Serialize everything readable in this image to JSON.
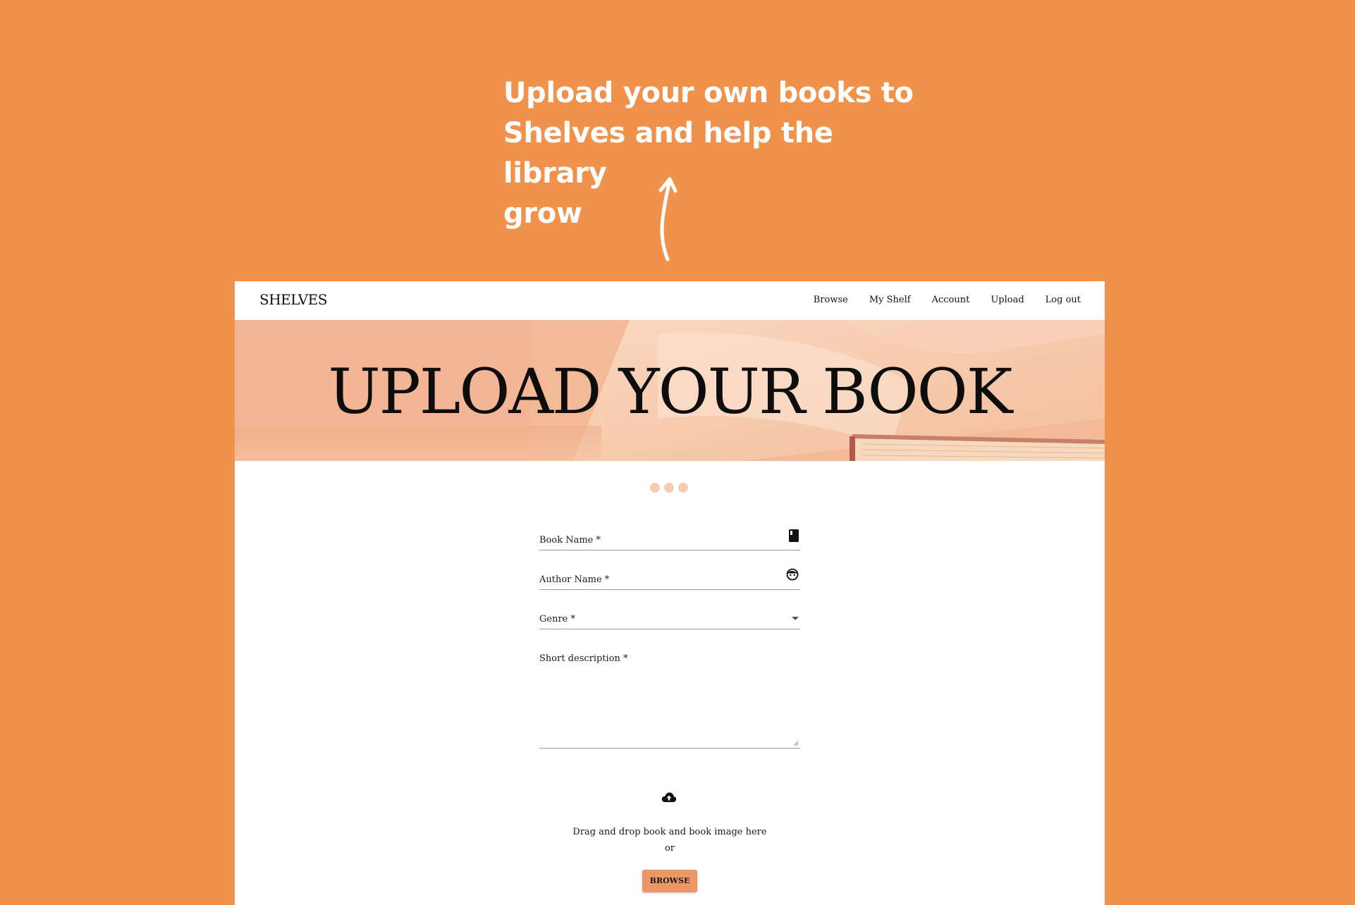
{
  "caption": {
    "line1": "Upload your own books to",
    "line2": "Shelves and help the library",
    "line3": "grow"
  },
  "navbar": {
    "brand": "SHELVES",
    "links": [
      "Browse",
      "My Shelf",
      "Account",
      "Upload",
      "Log out"
    ]
  },
  "hero": {
    "title": "UPLOAD YOUR BOOK"
  },
  "steps": {
    "count": 3,
    "color": "#F7CBB0"
  },
  "form": {
    "book_name_label": "Book Name *",
    "author_name_label": "Author Name *",
    "genre_label": "Genre *",
    "description_label": "Short description *"
  },
  "upload": {
    "drop_text": "Drag and drop book and book image here",
    "or_text": "or",
    "browse_label": "BROWSE"
  },
  "icons": {
    "book_field": "book-icon",
    "author_field": "face-icon",
    "genre_field": "dropdown-arrow-icon",
    "upload_area": "cloud-upload-icon"
  },
  "colors": {
    "background": "#F0924B",
    "accent_button": "#EE9766",
    "hero_tint": "#F4C0A0"
  }
}
